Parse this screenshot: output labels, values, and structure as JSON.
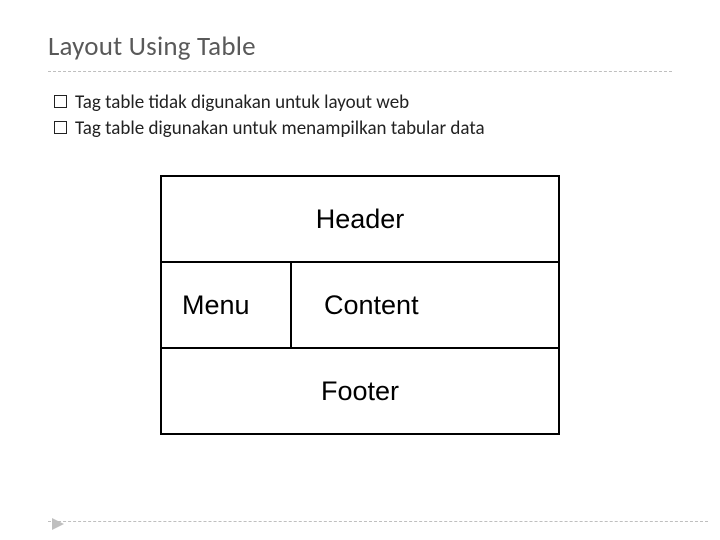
{
  "title": "Layout Using Table",
  "bullets": [
    "Tag table tidak digunakan untuk layout web",
    "Tag table digunakan untuk menampilkan tabular data"
  ],
  "layout": {
    "header": "Header",
    "menu": "Menu",
    "content": "Content",
    "footer": "Footer"
  }
}
